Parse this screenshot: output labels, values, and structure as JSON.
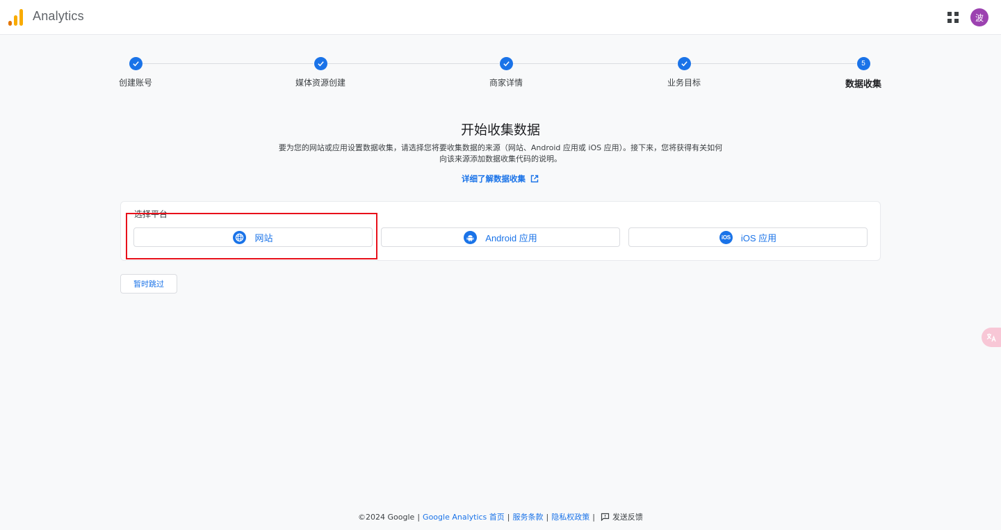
{
  "header": {
    "app_title": "Analytics",
    "avatar_initial": "波",
    "logo_colors": [
      "#f9ab00",
      "#e37400"
    ]
  },
  "stepper": {
    "steps": [
      {
        "label": "创建账号",
        "status": "done"
      },
      {
        "label": "媒体资源创建",
        "status": "done"
      },
      {
        "label": "商家详情",
        "status": "done"
      },
      {
        "label": "业务目标",
        "status": "done"
      },
      {
        "label": "数据收集",
        "status": "current",
        "number": "5"
      }
    ]
  },
  "main": {
    "title": "开始收集数据",
    "description": "要为您的网站或应用设置数据收集，请选择您将要收集数据的来源（网站、Android 应用或 iOS 应用）。接下来，您将获得有关如何向该来源添加数据收集代码的说明。",
    "learn_more": "详细了解数据收集"
  },
  "platform": {
    "label": "选择平台",
    "options": [
      {
        "label": "网站",
        "icon": "globe-icon"
      },
      {
        "label": "Android 应用",
        "icon": "android-icon"
      },
      {
        "label": "iOS 应用",
        "icon": "ios-icon",
        "icon_text": "iOS"
      }
    ]
  },
  "skip_label": "暂时跳过",
  "footer": {
    "copyright": "©2024 Google",
    "links": [
      "Google Analytics 首页",
      "服务条款",
      "隐私权政策"
    ],
    "separator": "|",
    "feedback": "发送反馈"
  },
  "colors": {
    "accent": "#1a73e8",
    "highlight": "#e8101a",
    "avatar": "#9c42b0"
  }
}
